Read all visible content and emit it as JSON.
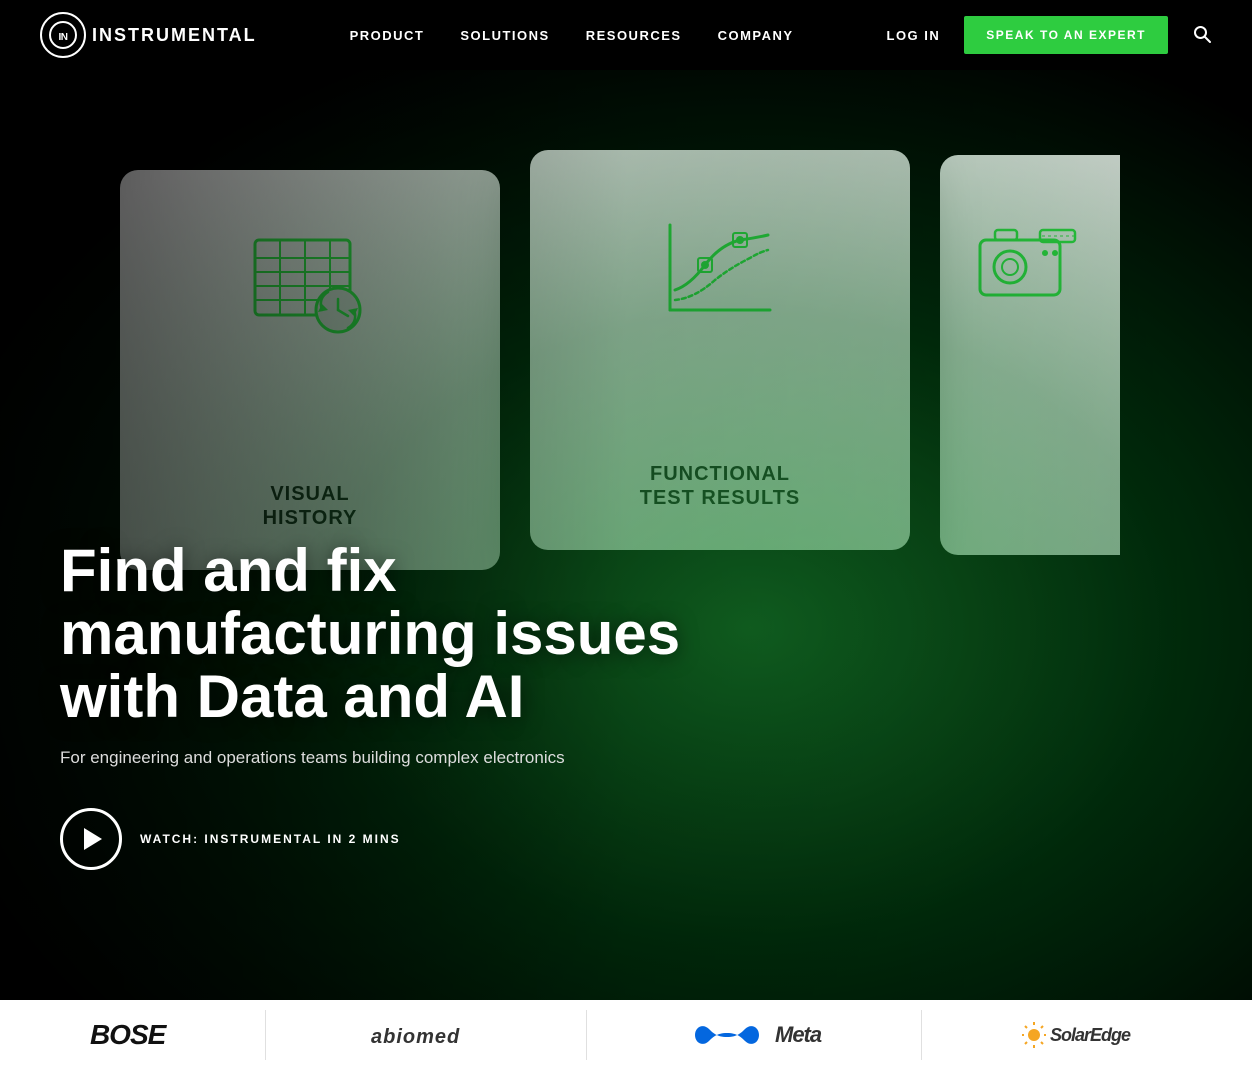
{
  "nav": {
    "logo_text": "INSTRUMENTAL",
    "logo_short": "IN",
    "links": [
      {
        "label": "PRODUCT",
        "id": "product"
      },
      {
        "label": "SOLUTIONS",
        "id": "solutions"
      },
      {
        "label": "RESOURCES",
        "id": "resources"
      },
      {
        "label": "COMPANY",
        "id": "company"
      }
    ],
    "login_label": "LOG IN",
    "cta_label": "SPEAK TO AN EXPERT"
  },
  "hero": {
    "heading": "Find and fix manufacturing issues with Data and AI",
    "subtext": "For engineering and operations teams building complex electronics",
    "watch_label": "WATCH: INSTRUMENTAL IN 2 MINS",
    "cards": [
      {
        "id": "visual-history",
        "label_line1": "VISUAL",
        "label_line2": "HISTORY"
      },
      {
        "id": "functional-test",
        "label_line1": "FUNCTIONAL",
        "label_line2": "TEST RESULTS"
      },
      {
        "id": "camera-partial",
        "label_line1": "",
        "label_line2": ""
      }
    ]
  },
  "logo_bar": {
    "companies": [
      {
        "label": "BOSE",
        "style": "italic"
      },
      {
        "label": "abiomed",
        "style": "normal"
      },
      {
        "label": "Meta",
        "style": "normal"
      },
      {
        "label": "SolarEdge",
        "style": "normal"
      }
    ]
  }
}
